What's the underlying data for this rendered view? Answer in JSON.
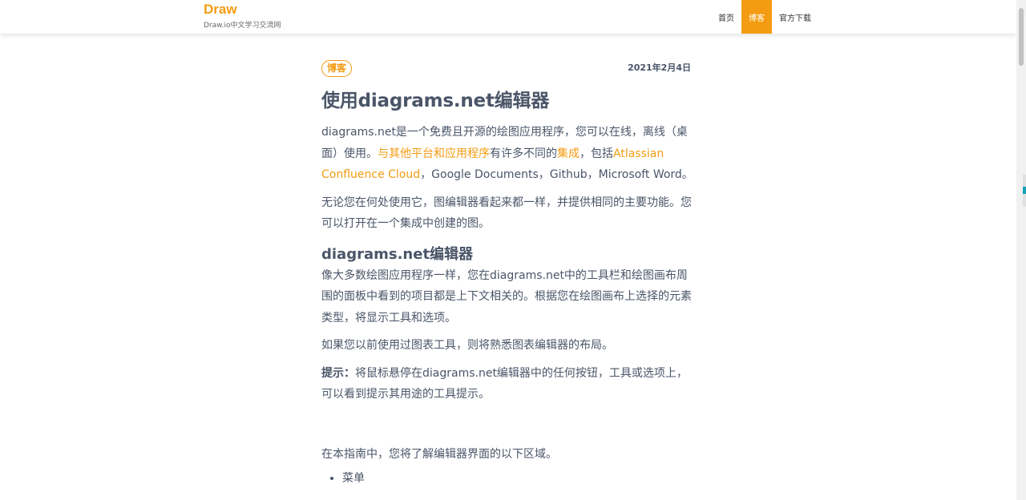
{
  "header": {
    "brand_title": "Draw",
    "brand_subtitle": "Draw.io中文学习交流网",
    "nav": [
      {
        "label": "首页",
        "active": false
      },
      {
        "label": "博客",
        "active": true
      },
      {
        "label": "官方下载",
        "active": false
      }
    ],
    "accent_color": "#f39c12"
  },
  "post": {
    "tag": "博客",
    "date": "2021年2月4日",
    "title": "使用diagrams.net编辑器",
    "p1": {
      "a": "diagrams.net是一个免费且开源的绘图应用程序，您可以在线，离线（桌面）使用。",
      "link1": "与其他平台和应用程序",
      "b": "有许多不同的",
      "link2": "集成",
      "c": "，包括",
      "link3": "Atlassian Confluence Cloud",
      "d": "，Google Documents，Github，Microsoft Word。"
    },
    "p2": "无论您在何处使用它，图编辑器看起来都一样，并提供相同的主要功能。您可以打开在一个集成中创建的图。",
    "h2": "diagrams.net编辑器",
    "p3": "像大多数绘图应用程序一样，您在diagrams.net中的工具栏和绘图画布周围的面板中看到的项目都是上下文相关的。根据您在绘图画布上选择的元素类型，将显示工具和选项。",
    "p4": "如果您以前使用过图表工具，则将熟悉图表编辑器的布局。",
    "tip_label": "提示：",
    "tip_text": "将鼠标悬停在diagrams.net编辑器中的任何按钮，工具或选项上，可以看到提示其用途的工具提示。",
    "p5": "在本指南中，您将了解编辑器界面的以下区域。",
    "list": [
      "菜单"
    ]
  }
}
